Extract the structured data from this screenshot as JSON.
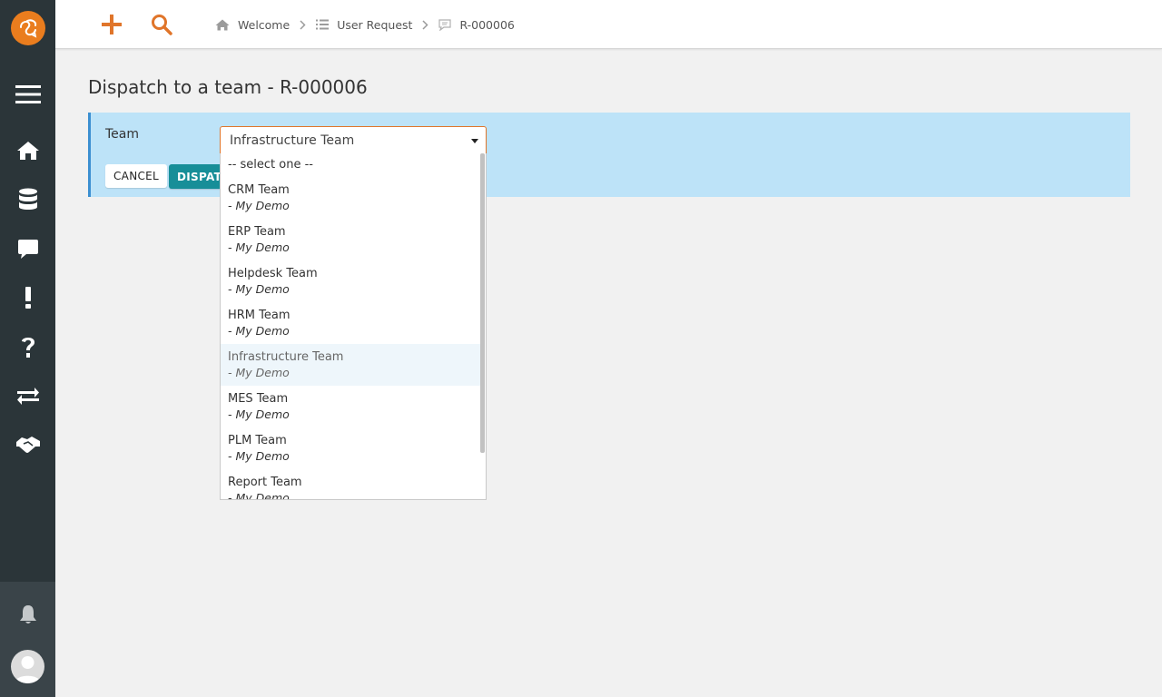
{
  "app": {
    "sidebar": {
      "items": [
        {
          "icon": "menu-icon"
        },
        {
          "icon": "home-icon"
        },
        {
          "icon": "database-icon"
        },
        {
          "icon": "comment-icon"
        },
        {
          "icon": "exclamation-icon"
        },
        {
          "icon": "question-icon"
        },
        {
          "icon": "exchange-icon"
        },
        {
          "icon": "handshake-icon"
        }
      ],
      "bottom": [
        {
          "icon": "bell-icon"
        },
        {
          "icon": "user-avatar-icon"
        }
      ]
    },
    "accent_color": "#ea7d1e",
    "sidebar_color": "#2b3539"
  },
  "topbar": {
    "new_icon": "plus-icon",
    "search_icon": "search-icon",
    "breadcrumb": [
      {
        "label": "Welcome",
        "icon": "home-icon"
      },
      {
        "label": "User Request",
        "icon": "list-icon"
      },
      {
        "label": "R-000006",
        "icon": "ticket-icon"
      }
    ]
  },
  "main": {
    "title": "Dispatch to a team - R-000006",
    "form": {
      "team_label": "Team",
      "team_select": {
        "value": "Infrastructure Team",
        "placeholder_option": "-- select one --",
        "options": [
          {
            "name": "CRM Team",
            "org": "- My Demo"
          },
          {
            "name": "ERP Team",
            "org": "- My Demo"
          },
          {
            "name": "Helpdesk Team",
            "org": "- My Demo"
          },
          {
            "name": "HRM Team",
            "org": "- My Demo"
          },
          {
            "name": "Infrastructure Team",
            "org": "- My Demo"
          },
          {
            "name": "MES Team",
            "org": "- My Demo"
          },
          {
            "name": "PLM Team",
            "org": "- My Demo"
          },
          {
            "name": "Report Team",
            "org": "- My Demo"
          }
        ]
      },
      "cancel_label": "CANCEL",
      "dispatch_label": "DISPATCH"
    }
  }
}
